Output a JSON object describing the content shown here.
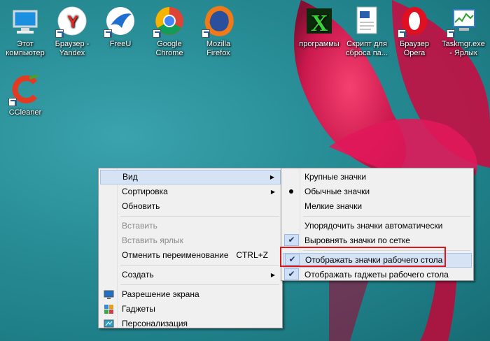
{
  "desktop_icons": [
    {
      "label_line1": "Этот",
      "label_line2": "компьютер",
      "icon": "computer-icon"
    },
    {
      "label_line1": "Браузер -",
      "label_line2": "Yandex",
      "icon": "yandex-browser-icon"
    },
    {
      "label_line1": "FreeU",
      "label_line2": "",
      "icon": "freeu-icon"
    },
    {
      "label_line1": "Google",
      "label_line2": "Chrome",
      "icon": "chrome-icon"
    },
    {
      "label_line1": "Mozilla",
      "label_line2": "Firefox",
      "icon": "firefox-icon"
    },
    {
      "label_line1": "программы",
      "label_line2": "",
      "icon": "programs-icon"
    },
    {
      "label_line1": "Скрипт для",
      "label_line2": "сброса па...",
      "icon": "script-file-icon"
    },
    {
      "label_line1": "Браузер",
      "label_line2": "Opera",
      "icon": "opera-icon"
    },
    {
      "label_line1": "Taskmgr.exe",
      "label_line2": "- Ярлык",
      "icon": "taskmgr-icon"
    },
    {
      "label_line1": "CCleaner",
      "label_line2": "",
      "icon": "ccleaner-icon"
    }
  ],
  "context_menu": {
    "view": "Вид",
    "sort": "Сортировка",
    "refresh": "Обновить",
    "paste": "Вставить",
    "paste_shortcut": "Вставить ярлык",
    "undo_rename": "Отменить переименование",
    "undo_rename_shortcut": "CTRL+Z",
    "create": "Создать",
    "screen_resolution": "Разрешение экрана",
    "gadgets": "Гаджеты",
    "personalization": "Персонализация"
  },
  "view_submenu": {
    "large_icons": "Крупные значки",
    "medium_icons": "Обычные значки",
    "small_icons": "Мелкие значки",
    "auto_arrange": "Упорядочить значки автоматически",
    "align_to_grid": "Выровнять значки по сетке",
    "show_desktop_icons": "Отображать значки рабочего стола",
    "show_gadgets": "Отображать гаджеты  рабочего стола"
  },
  "colors": {
    "highlight_border": "#e0151b",
    "menu_hover": "#d5e3f5"
  }
}
